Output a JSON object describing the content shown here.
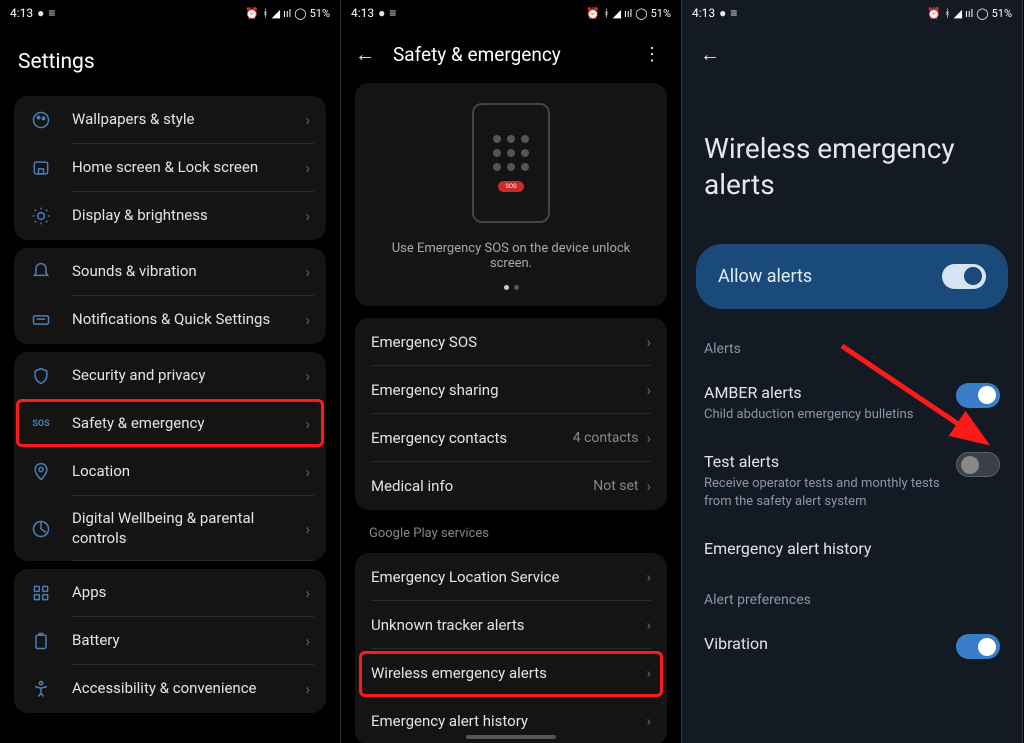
{
  "status": {
    "time": "4:13",
    "battery": "51%"
  },
  "screen1": {
    "title": "Settings",
    "groups": [
      [
        {
          "label": "Wallpapers & style",
          "icon": "palette"
        },
        {
          "label": "Home screen & Lock screen",
          "icon": "home"
        },
        {
          "label": "Display & brightness",
          "icon": "sun"
        }
      ],
      [
        {
          "label": "Sounds & vibration",
          "icon": "bell"
        },
        {
          "label": "Notifications & Quick Settings",
          "icon": "notification"
        }
      ],
      [
        {
          "label": "Security and privacy",
          "icon": "shield"
        },
        {
          "label": "Safety & emergency",
          "icon": "sos",
          "highlight": true
        },
        {
          "label": "Location",
          "icon": "pin"
        },
        {
          "label": "Digital Wellbeing & parental controls",
          "icon": "wellbeing"
        }
      ],
      [
        {
          "label": "Apps",
          "icon": "apps"
        },
        {
          "label": "Battery",
          "icon": "battery"
        },
        {
          "label": "Accessibility & convenience",
          "icon": "accessibility"
        }
      ]
    ]
  },
  "screen2": {
    "title": "Safety & emergency",
    "sos_caption": "Use Emergency SOS on the device unlock screen.",
    "rows1": [
      {
        "label": "Emergency SOS"
      },
      {
        "label": "Emergency sharing"
      },
      {
        "label": "Emergency contacts",
        "value": "4 contacts"
      },
      {
        "label": "Medical info",
        "value": "Not set"
      }
    ],
    "gps_header": "Google Play services",
    "rows2": [
      {
        "label": "Emergency Location Service"
      },
      {
        "label": "Unknown tracker alerts"
      },
      {
        "label": "Wireless emergency alerts",
        "highlight": true
      },
      {
        "label": "Emergency alert history"
      }
    ]
  },
  "screen3": {
    "title": "Wireless emergency alerts",
    "allow_label": "Allow alerts",
    "alerts_header": "Alerts",
    "alerts": [
      {
        "title": "AMBER alerts",
        "sub": "Child abduction emergency bulletins",
        "on": true
      },
      {
        "title": "Test alerts",
        "sub": "Receive operator tests and monthly tests from the safety alert system",
        "on": false
      },
      {
        "title": "Emergency alert history",
        "sub": ""
      }
    ],
    "prefs_header": "Alert preferences",
    "vibration_label": "Vibration"
  }
}
